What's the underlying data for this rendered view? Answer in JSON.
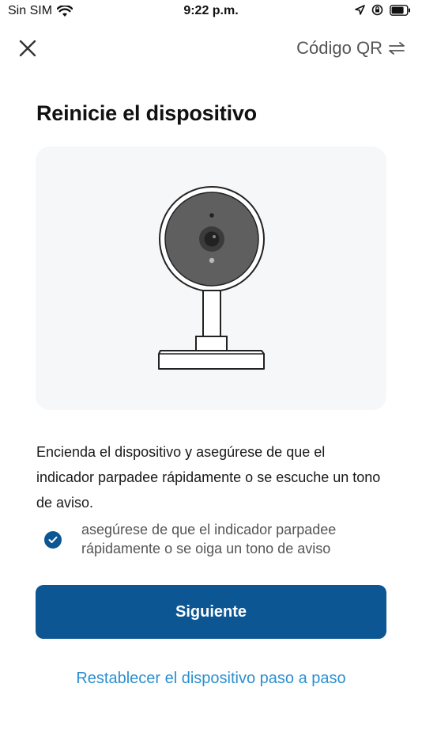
{
  "status_bar": {
    "carrier": "Sin SIM",
    "time": "9:22 p.m."
  },
  "nav": {
    "close_icon": "close-icon",
    "qr_label": "Código QR",
    "qr_icon": "swap-arrows-icon"
  },
  "title": "Reinicie el dispositivo",
  "illustration": {
    "icon": "security-camera-icon"
  },
  "instructions": "Encienda el dispositivo y asegúrese de que el indicador parpadee rápidamente o se escuche un tono de aviso.",
  "confirmation": {
    "checked": true,
    "text": "asegúrese de que el indicador parpadee rápidamente o se oiga un tono de aviso"
  },
  "primary_button": "Siguiente",
  "reset_link": "Restablecer el dispositivo paso a paso",
  "colors": {
    "primary": "#0b5693",
    "link": "#2b8fd0"
  }
}
